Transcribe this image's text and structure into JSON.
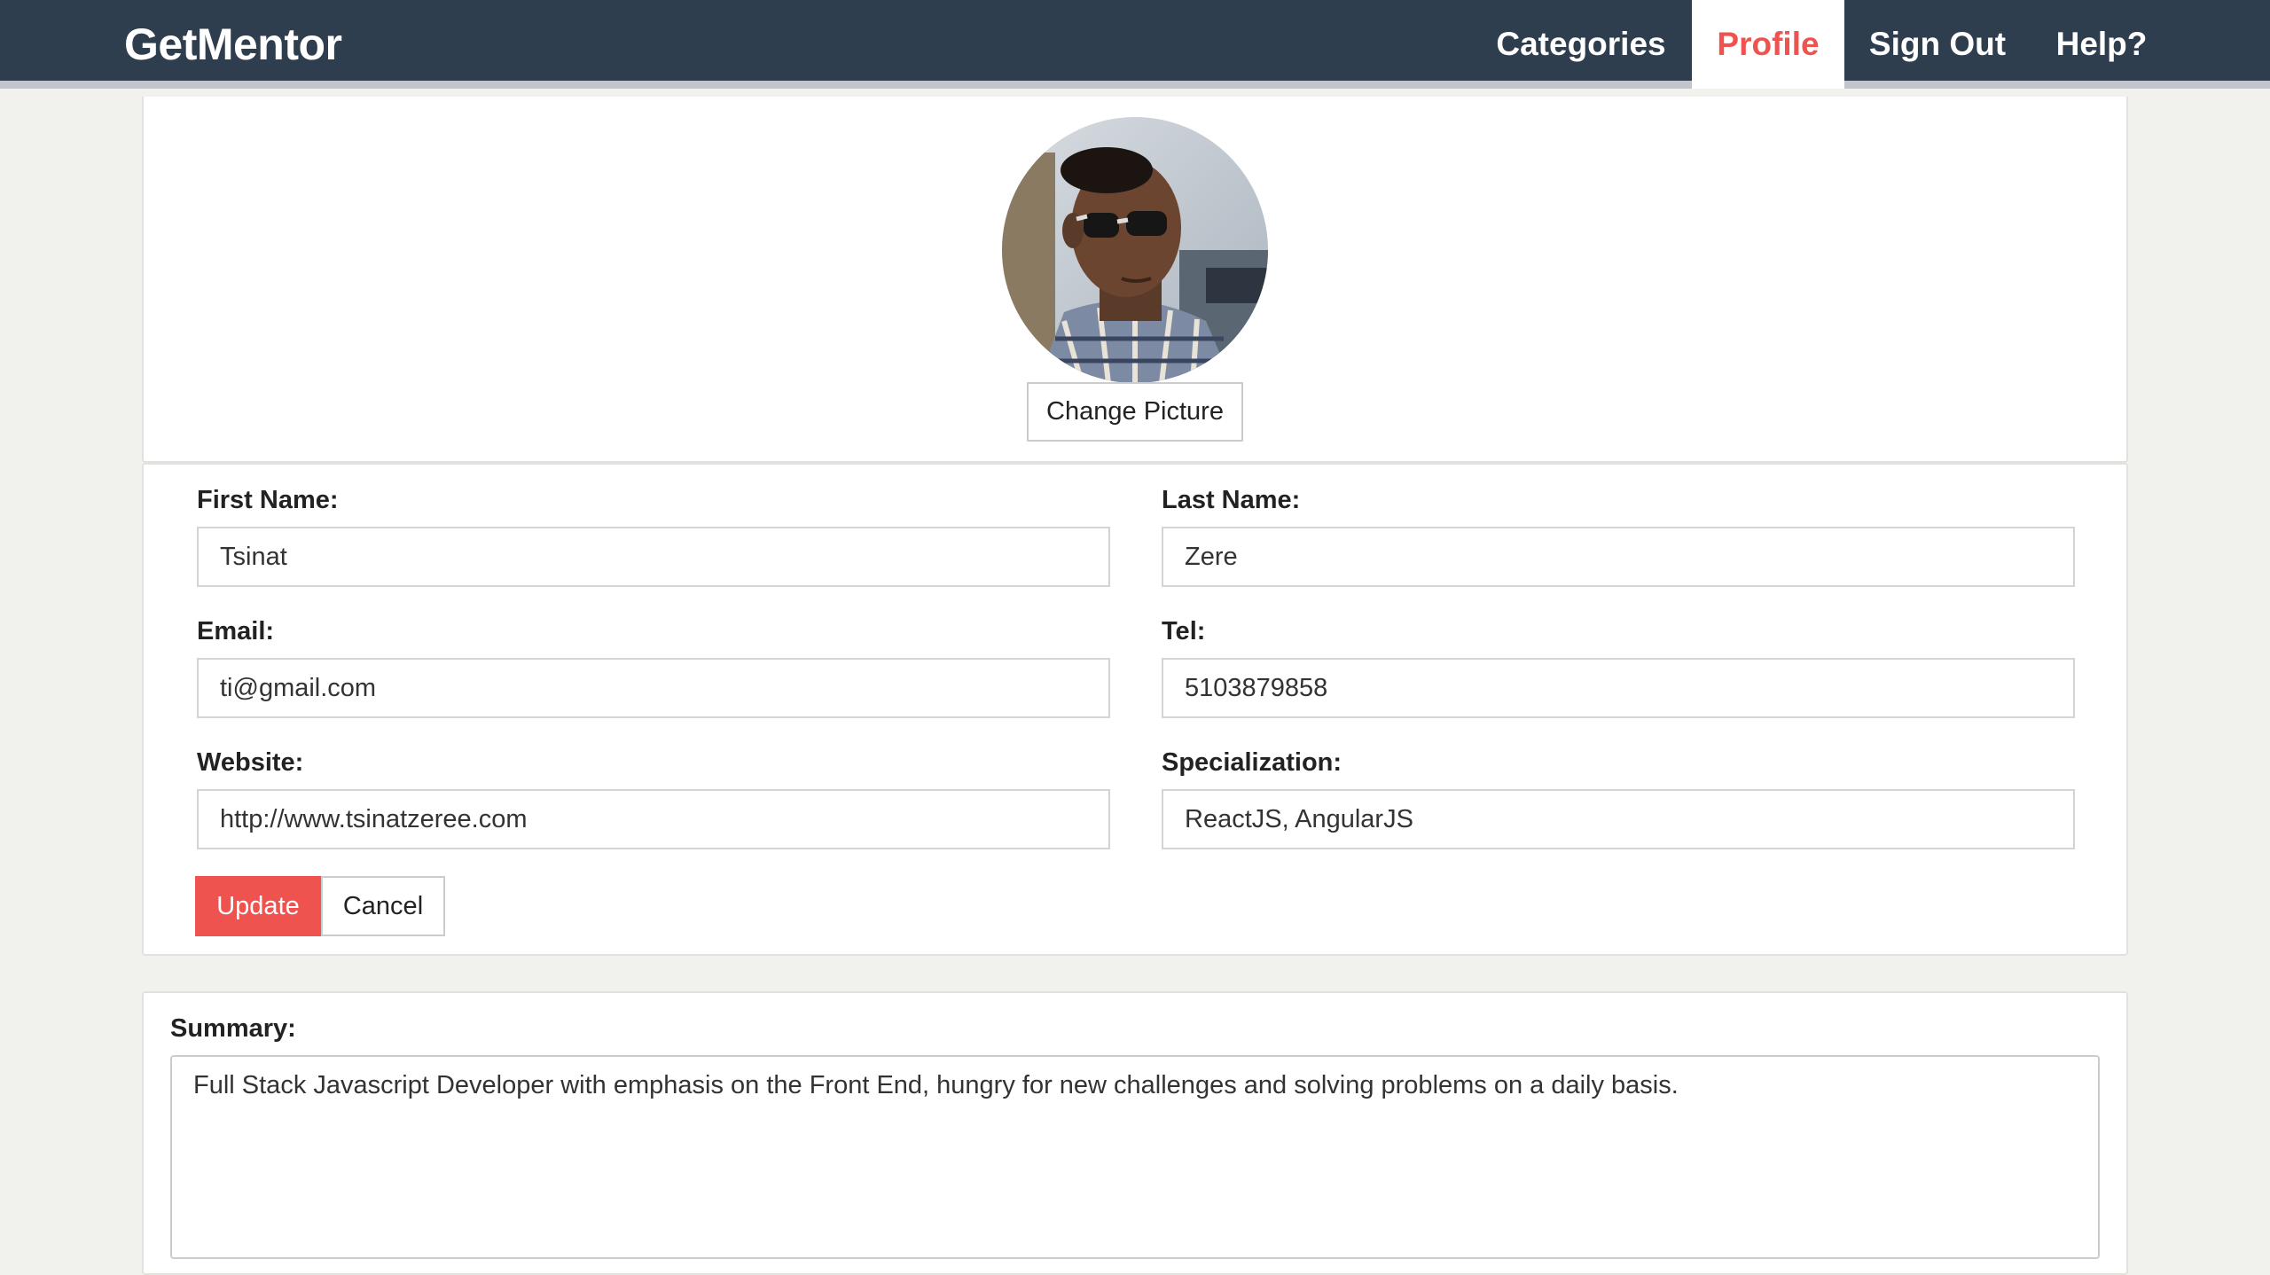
{
  "header": {
    "brand": "GetMentor",
    "nav": [
      {
        "label": "Categories",
        "active": false
      },
      {
        "label": "Profile",
        "active": true
      },
      {
        "label": "Sign Out",
        "active": false
      },
      {
        "label": "Help?",
        "active": false
      }
    ]
  },
  "photo": {
    "change_picture_label": "Change Picture"
  },
  "form": {
    "first_name": {
      "label": "First Name:",
      "value": "Tsinat"
    },
    "last_name": {
      "label": "Last Name:",
      "value": "Zere"
    },
    "email": {
      "label": "Email:",
      "value": "ti@gmail.com"
    },
    "tel": {
      "label": "Tel:",
      "value": "5103879858"
    },
    "website": {
      "label": "Website:",
      "value": "http://www.tsinatzeree.com"
    },
    "specialization": {
      "label": "Specialization:",
      "value": "ReactJS, AngularJS"
    },
    "update_label": "Update",
    "cancel_label": "Cancel"
  },
  "summary": {
    "label": "Summary:",
    "value": "Full Stack Javascript Developer with emphasis on the Front End, hungry for new challenges and solving problems on a daily basis."
  },
  "colors": {
    "navbar": "#2e3e4e",
    "accent": "#ef5350",
    "page_bg": "#f1f1ed"
  }
}
